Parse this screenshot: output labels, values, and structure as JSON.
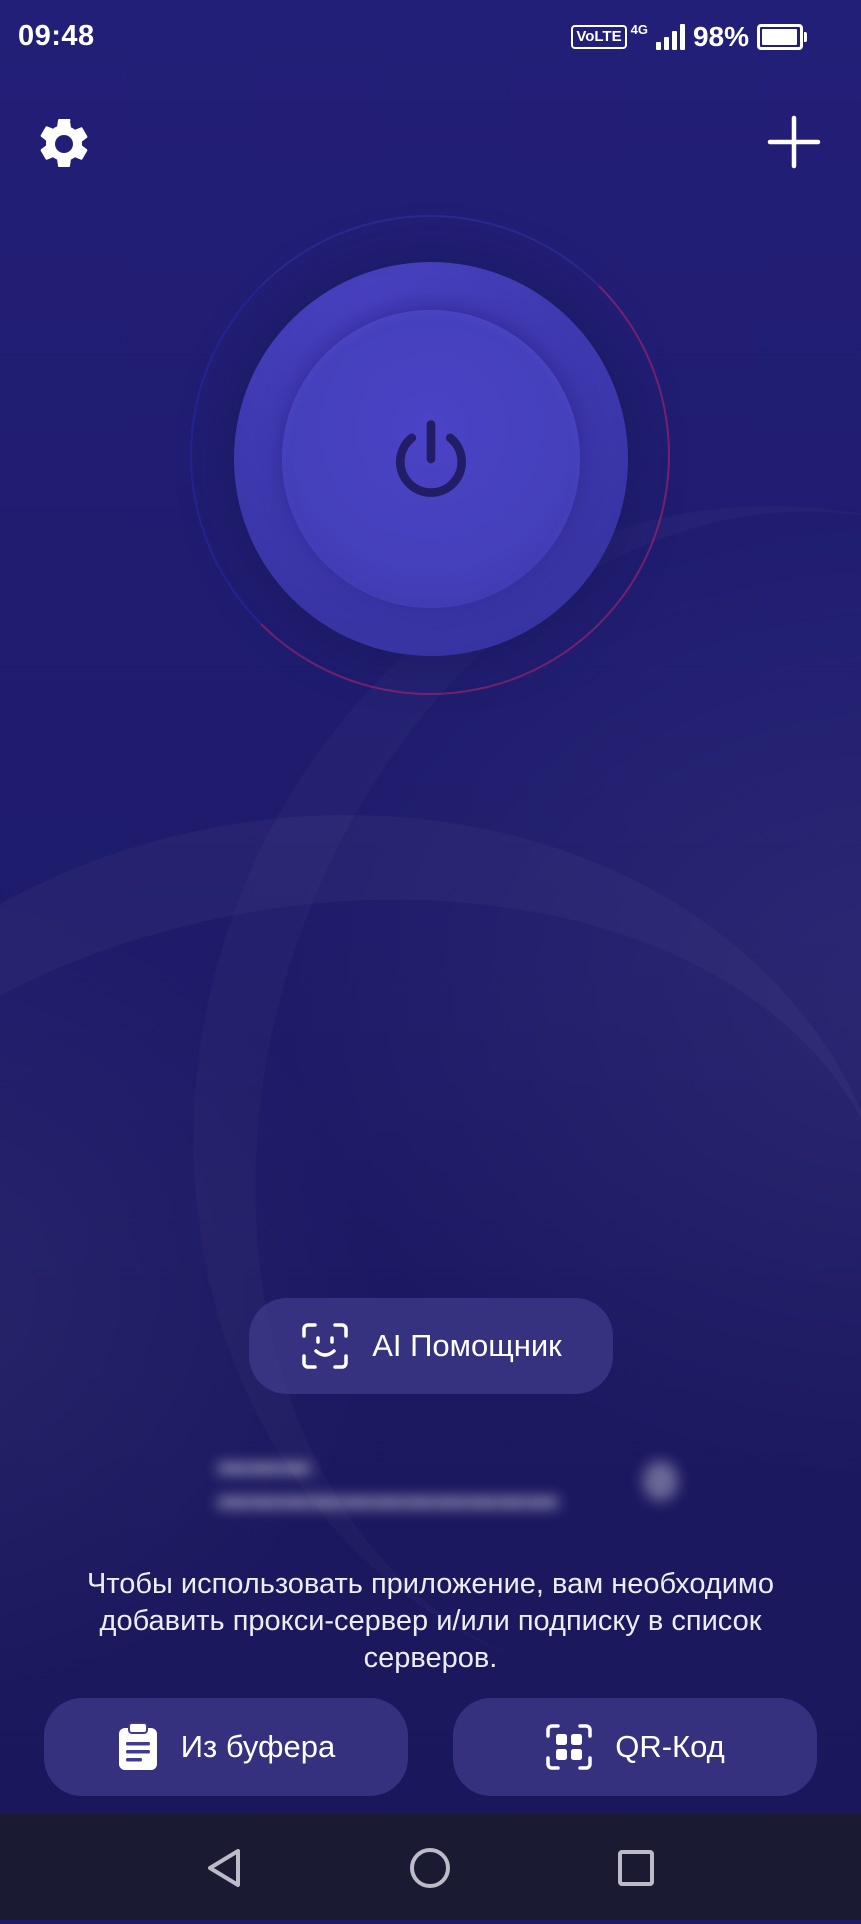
{
  "status_bar": {
    "time": "09:48",
    "volte": "VoLTE",
    "network": "4G",
    "battery_percent": "98%",
    "battery_level": 0.98
  },
  "header": {
    "settings_icon": "gear-icon",
    "add_icon": "plus-icon"
  },
  "power": {
    "icon": "power-icon",
    "colors": {
      "outer": "#3f39b0",
      "inner": "#4540bb",
      "icon": "#221d66"
    }
  },
  "ai_assistant": {
    "label": "AI Помощник",
    "icon": "face-scan-icon"
  },
  "hint_text": "Чтобы использовать приложение, вам необходимо добавить прокси-сервер и/или подписку в список серверов.",
  "actions": {
    "clipboard": {
      "label": "Из буфера",
      "icon": "clipboard-icon"
    },
    "qr": {
      "label": "QR-Код",
      "icon": "qr-scan-icon"
    }
  },
  "nav": {
    "back_icon": "back-triangle-icon",
    "home_icon": "home-circle-icon",
    "recent_icon": "recent-square-icon"
  },
  "theme": {
    "background": "#1e1b66",
    "button": "#3d3a8a",
    "text": "#ffffff",
    "nav_bar": "#1b1a33"
  }
}
